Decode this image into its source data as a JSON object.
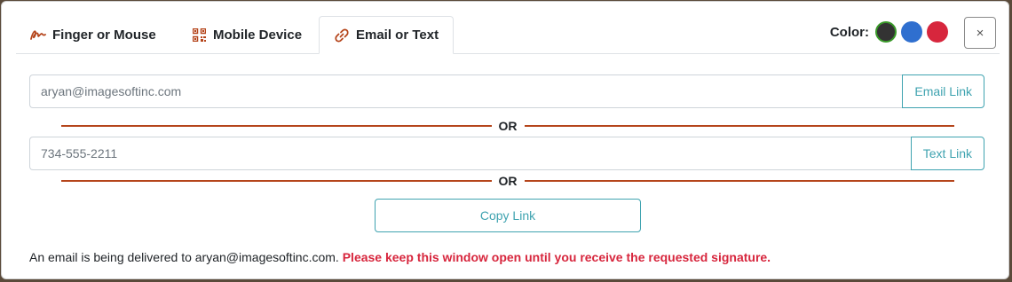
{
  "tabs": [
    {
      "label": "Finger or Mouse",
      "icon": "signature-icon",
      "active": false
    },
    {
      "label": "Mobile Device",
      "icon": "qr-code-icon",
      "active": false
    },
    {
      "label": "Email or Text",
      "icon": "link-icon",
      "active": true
    }
  ],
  "color_picker": {
    "label": "Color:",
    "swatches": [
      {
        "name": "black",
        "color": "#333333",
        "selected": true
      },
      {
        "name": "blue",
        "color": "#2f6fcf",
        "selected": false
      },
      {
        "name": "red",
        "color": "#d7263d",
        "selected": false
      }
    ]
  },
  "close_button": {
    "label": "×"
  },
  "email": {
    "value": "aryan@imagesoftinc.com",
    "button": "Email Link"
  },
  "divider_text": "OR",
  "phone": {
    "value": "734-555-2211",
    "button": "Text Link"
  },
  "copy_button": "Copy Link",
  "status": {
    "message": "An email is being delivered to aryan@imagesoftinc.com.",
    "warning": "Please keep this window open until you receive the requested signature."
  },
  "colors": {
    "accent": "#3fa3b0",
    "divider": "#b5451b",
    "warning": "#d7263d"
  }
}
